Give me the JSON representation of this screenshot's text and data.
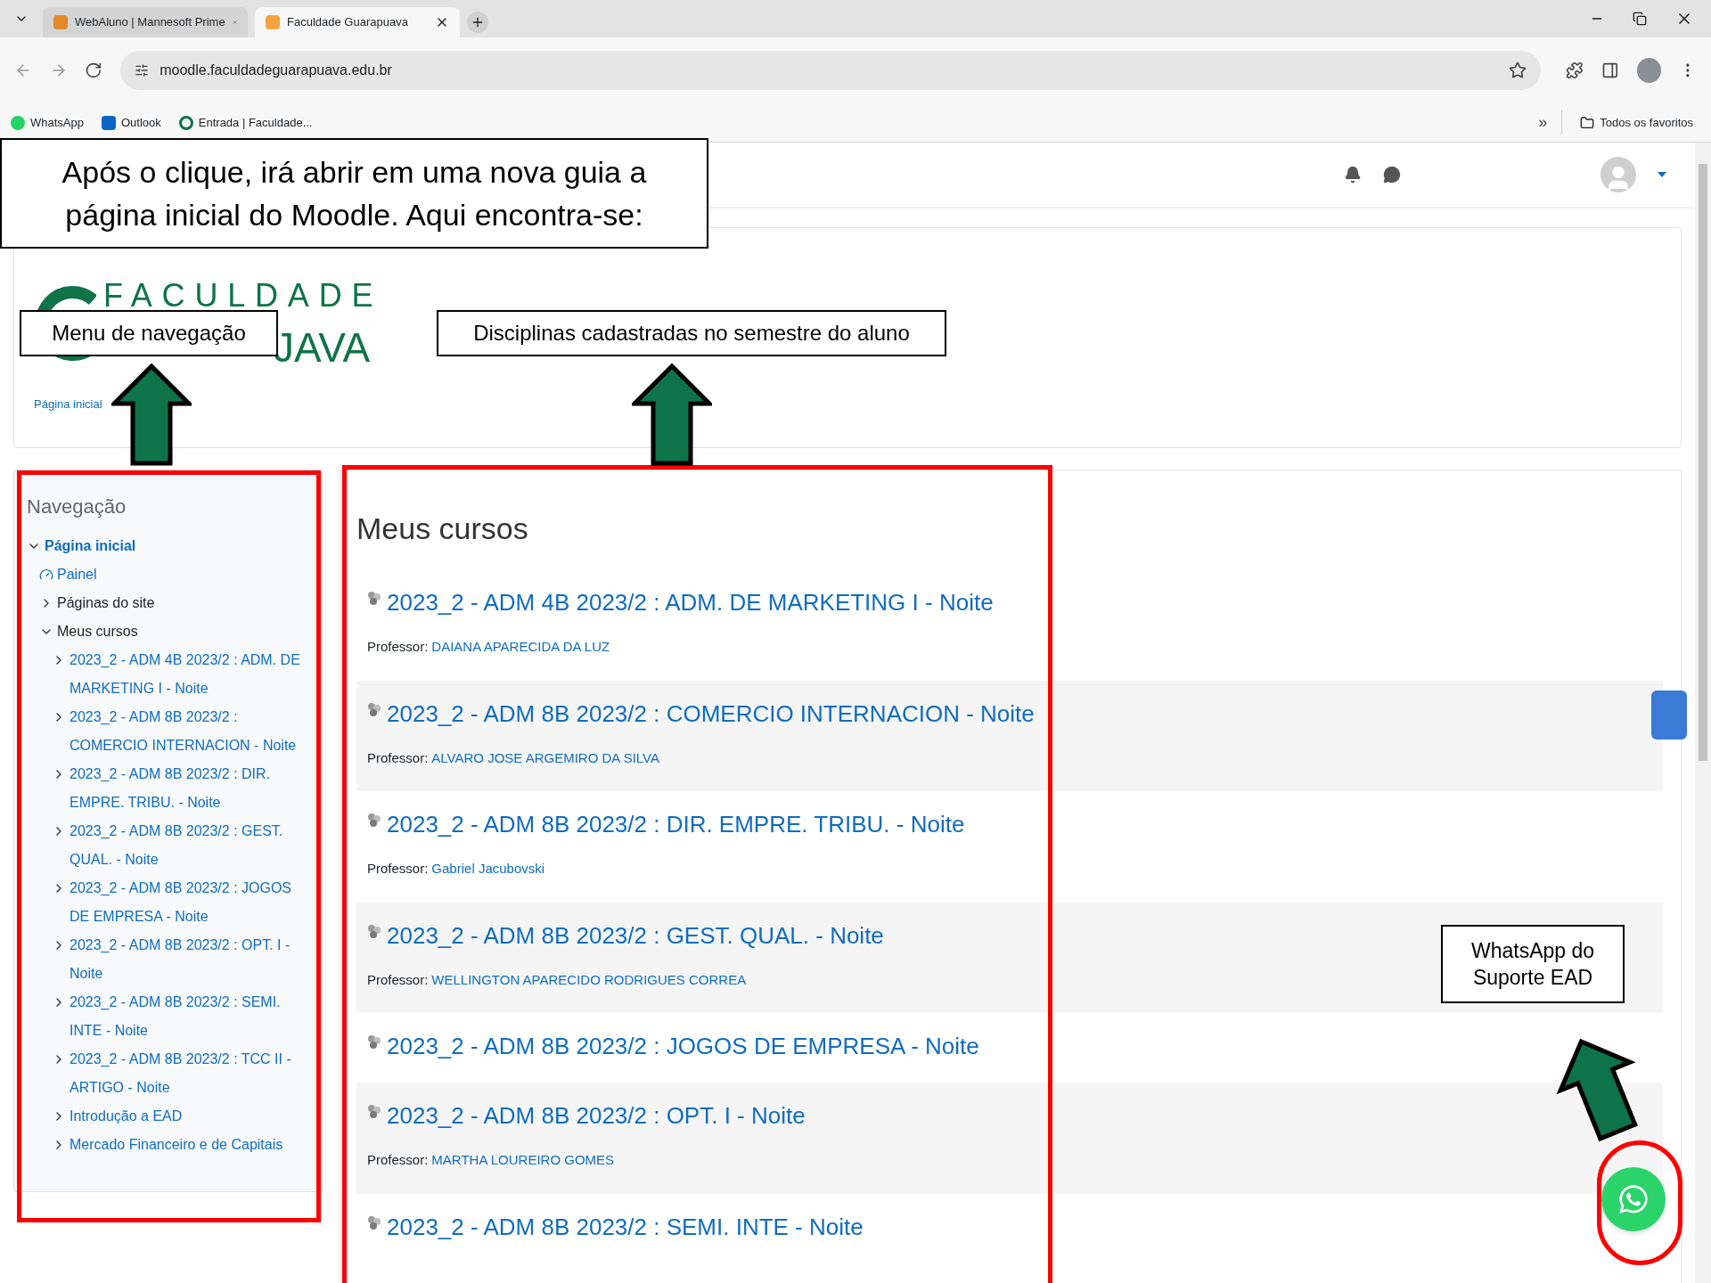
{
  "browser": {
    "tabs": [
      {
        "title": "WebAluno | Mannesoft Prime",
        "selected": false
      },
      {
        "title": "Faculdade Guarapuava",
        "selected": true
      }
    ],
    "address": "moodle.faculdadeguarapuava.edu.br",
    "bookmarks": [
      {
        "label": "WhatsApp",
        "kind": "whatsapp"
      },
      {
        "label": "Outlook",
        "kind": "outlook"
      },
      {
        "label": "Entrada | Faculdade...",
        "kind": "faculdade"
      }
    ],
    "overflow": "»",
    "all_bookmarks": "Todos os favoritos"
  },
  "header": {
    "logo_line1": "FACULDADE",
    "logo_line2": "JAVA",
    "breadcrumb": "Página inicial"
  },
  "navigation": {
    "title": "Navegação",
    "tree": [
      {
        "label": "Página inicial",
        "kind": "root",
        "expanded": true,
        "children": [
          {
            "label": "Painel",
            "kind": "link"
          },
          {
            "label": "Páginas do site",
            "kind": "category",
            "expanded": false
          },
          {
            "label": "Meus cursos",
            "kind": "category",
            "expanded": true,
            "children": [
              {
                "label": "2023_2 - ADM 4B 2023/2 : ADM. DE MARKETING I - Noite",
                "kind": "course",
                "expanded": false
              },
              {
                "label": "2023_2 - ADM 8B 2023/2 : COMERCIO INTERNACION - Noite",
                "kind": "course",
                "expanded": false
              },
              {
                "label": "2023_2 - ADM 8B 2023/2 : DIR. EMPRE. TRIBU. - Noite",
                "kind": "course",
                "expanded": false
              },
              {
                "label": "2023_2 - ADM 8B 2023/2 : GEST. QUAL. - Noite",
                "kind": "course",
                "expanded": false
              },
              {
                "label": "2023_2 - ADM 8B 2023/2 : JOGOS DE EMPRESA - Noite",
                "kind": "course",
                "expanded": false
              },
              {
                "label": "2023_2 - ADM 8B 2023/2 : OPT. I - Noite",
                "kind": "course",
                "expanded": false
              },
              {
                "label": "2023_2 - ADM 8B 2023/2 : SEMI. INTE - Noite",
                "kind": "course",
                "expanded": false
              },
              {
                "label": "2023_2 - ADM 8B 2023/2 : TCC II - ARTIGO - Noite",
                "kind": "course",
                "expanded": false
              },
              {
                "label": "Introdução a EAD",
                "kind": "course",
                "expanded": false
              },
              {
                "label": "Mercado Financeiro e de Capitais",
                "kind": "course",
                "expanded": false
              }
            ]
          }
        ]
      }
    ]
  },
  "courses": {
    "title": "Meus cursos",
    "items": [
      {
        "title": "2023_2 - ADM 4B 2023/2 : ADM. DE MARKETING I - Noite",
        "teacher_label": "Professor:",
        "teacher": "DAIANA APARECIDA DA LUZ"
      },
      {
        "title": "2023_2 - ADM 8B 2023/2 : COMERCIO INTERNACION - Noite",
        "teacher_label": "Professor:",
        "teacher": "ALVARO JOSE ARGEMIRO DA SILVA"
      },
      {
        "title": "2023_2 - ADM 8B 2023/2 : DIR. EMPRE. TRIBU. - Noite",
        "teacher_label": "Professor:",
        "teacher": "Gabriel Jacubovski"
      },
      {
        "title": "2023_2 - ADM 8B 2023/2 : GEST. QUAL. - Noite",
        "teacher_label": "Professor:",
        "teacher": "WELLINGTON APARECIDO RODRIGUES CORREA"
      },
      {
        "title": "2023_2 - ADM 8B 2023/2 : JOGOS DE EMPRESA - Noite"
      },
      {
        "title": "2023_2 - ADM 8B 2023/2 : OPT. I - Noite",
        "teacher_label": "Professor:",
        "teacher": "MARTHA LOUREIRO GOMES"
      },
      {
        "title": "2023_2 - ADM 8B 2023/2 : SEMI. INTE - Noite"
      }
    ]
  },
  "annotations": {
    "intro": "Após o clique, irá abrir em uma nova guia a página inicial do Moodle. Aqui encontra-se:",
    "menu": "Menu de navegação",
    "courses": "Disciplinas cadastradas no semestre do aluno",
    "whatsapp": "WhatsApp do Suporte EAD"
  }
}
